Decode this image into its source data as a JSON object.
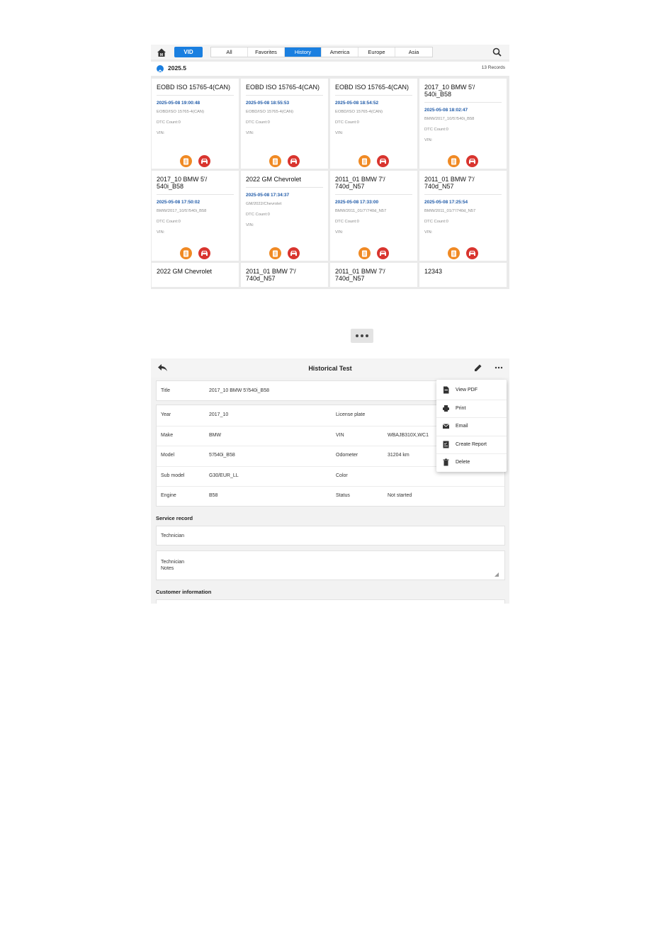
{
  "history": {
    "vid_label": "VID",
    "tabs": [
      {
        "label": "All",
        "active": false
      },
      {
        "label": "Favorites",
        "active": false
      },
      {
        "label": "History",
        "active": true
      },
      {
        "label": "America",
        "active": false
      },
      {
        "label": "Europe",
        "active": false
      },
      {
        "label": "Asia",
        "active": false
      }
    ],
    "group_label": "2025.5",
    "records_count": "13 Records",
    "cards": [
      {
        "title": "EOBD ISO 15765-4(CAN)",
        "time": "2025-05-08 19:00:48",
        "path": "EOBD/ISO 15765-4(CAN)",
        "dtc": "DTC Count:0",
        "vin": "VIN:"
      },
      {
        "title": "EOBD ISO 15765-4(CAN)",
        "time": "2025-05-08 18:55:53",
        "path": "EOBD/ISO 15765-4(CAN)",
        "dtc": "DTC Count:0",
        "vin": "VIN:"
      },
      {
        "title": "EOBD ISO 15765-4(CAN)",
        "time": "2025-05-08 18:54:52",
        "path": "EOBD/ISO 15765-4(CAN)",
        "dtc": "DTC Count:0",
        "vin": "VIN:"
      },
      {
        "title": "2017_10 BMW 5'/ 540i_B58",
        "time": "2025-05-08 18:02:47",
        "path": "BMW/2017_10/5'/540i_B58",
        "dtc": "DTC Count:0",
        "vin": "VIN:"
      },
      {
        "title": "2017_10 BMW 5'/ 540i_B58",
        "time": "2025-05-08 17:50:02",
        "path": "BMW/2017_10/5'/540i_B58",
        "dtc": "DTC Count:0",
        "vin": "VIN:"
      },
      {
        "title": "2022 GM Chevrolet",
        "time": "2025-05-08 17:34:37",
        "path": "GM/2022/Chevrolet",
        "dtc": "DTC Count:0",
        "vin": "VIN:"
      },
      {
        "title": "2011_01 BMW 7'/ 740d_N57",
        "time": "2025-05-08 17:33:00",
        "path": "BMW/2011_01/7'/740d_N57",
        "dtc": "DTC Count:0",
        "vin": "VIN:"
      },
      {
        "title": "2011_01 BMW 7'/ 740d_N57",
        "time": "2025-05-08 17:25:54",
        "path": "BMW/2011_01/7'/740d_N57",
        "dtc": "DTC Count:0",
        "vin": "VIN:"
      }
    ],
    "partial_cards": [
      {
        "title": "2022 GM Chevrolet"
      },
      {
        "title": "2011_01 BMW 7'/ 740d_N57"
      },
      {
        "title": "2011_01 BMW 7'/ 740d_N57"
      },
      {
        "title": "12343"
      }
    ]
  },
  "detail": {
    "title": "Historical Test",
    "title_row": {
      "label": "Title",
      "value": "2017_10 BMW 5'/540i_B58"
    },
    "left_fields": [
      {
        "label": "Year",
        "value": "2017_10"
      },
      {
        "label": "Make",
        "value": "BMW"
      },
      {
        "label": "Model",
        "value": "5'/540i_B58"
      },
      {
        "label": "Sub model",
        "value": "G30/EUR_LL"
      },
      {
        "label": "Engine",
        "value": "B58"
      }
    ],
    "right_fields": [
      {
        "label": "License plate",
        "value": ""
      },
      {
        "label": "VIN",
        "value": "WBAJB310X,WC1"
      },
      {
        "label": "Odometer",
        "value": "31204 km"
      },
      {
        "label": "Color",
        "value": ""
      },
      {
        "label": "Status",
        "value": "Not started"
      }
    ],
    "service_record_title": "Service record",
    "technician_label": "Technician",
    "technician_notes_label": "Technician Notes",
    "customer_info_title": "Customer information",
    "menu": [
      {
        "label": "View PDF",
        "icon": "pdf-icon"
      },
      {
        "label": "Print",
        "icon": "printer-icon"
      },
      {
        "label": "Email",
        "icon": "email-icon"
      },
      {
        "label": "Create Report",
        "icon": "report-icon"
      },
      {
        "label": "Delete",
        "icon": "trash-icon"
      }
    ]
  },
  "colors": {
    "accent": "#1a7fe0",
    "date_blue": "#1f5aa8",
    "report_orange": "#f08a24",
    "car_red": "#d9352f"
  }
}
